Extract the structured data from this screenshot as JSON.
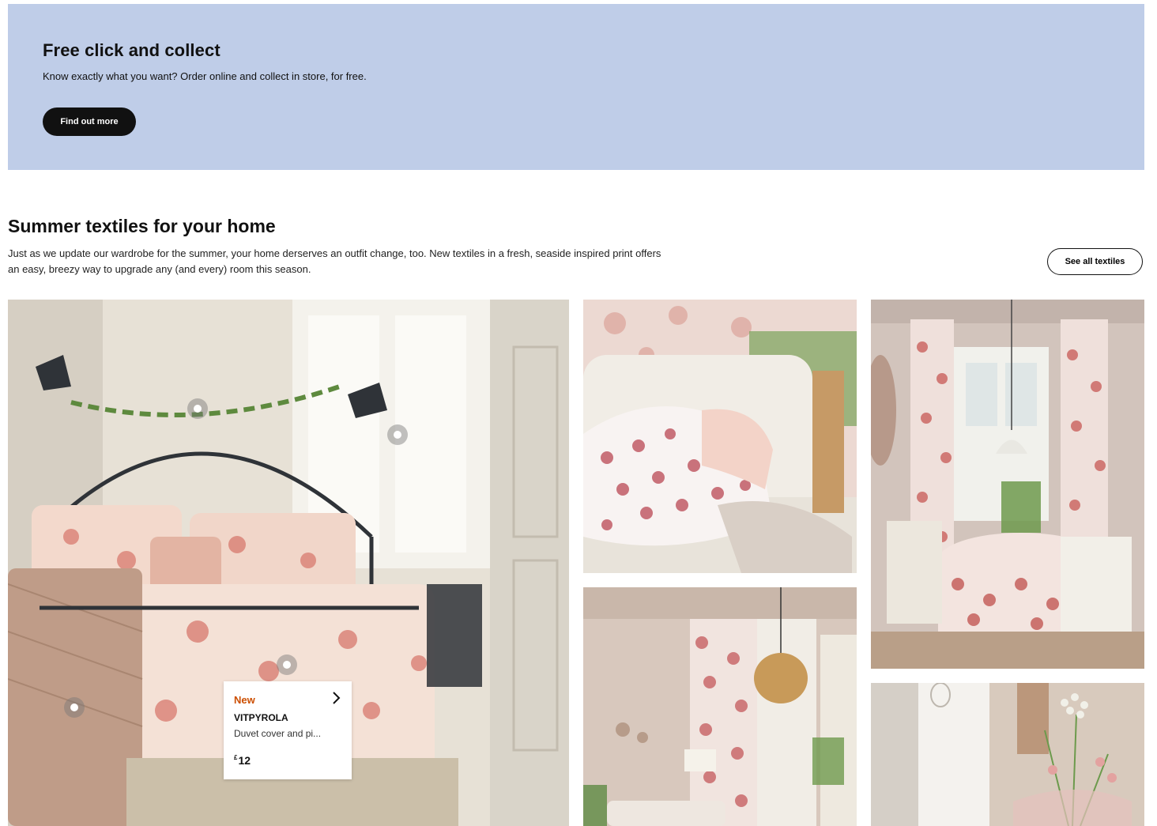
{
  "promo": {
    "title": "Free click and collect",
    "text": "Know exactly what you want? Order online and collect in store, for free.",
    "button_label": "Find out more",
    "background_color": "#bfcde8"
  },
  "section": {
    "title": "Summer textiles for your home",
    "description": "Just as we update our wardrobe for the summer, your home derserves an outfit change, too. New textiles in a fresh, seaside inspired print offers an easy, breezy way to upgrade any (and every) room this season.",
    "button_label": "See all textiles"
  },
  "gallery": {
    "images": [
      {
        "subject": "bedroom with coral print duvet set"
      },
      {
        "subject": "coral print cushion on sofa"
      },
      {
        "subject": "dining room with coral curtains and tablecloth"
      },
      {
        "subject": "living room with coral print curtain and rattan pendant"
      },
      {
        "subject": "flowers in vase by window"
      }
    ]
  },
  "product_card": {
    "tag": "New",
    "name": "VITPYROLA",
    "description": "Duvet cover and pi...",
    "currency": "£",
    "price": "12",
    "tag_color": "#cc4e00"
  },
  "icons": {
    "hotspot": "product-hotspot-icon",
    "card_arrow": "chevron-right-icon"
  }
}
